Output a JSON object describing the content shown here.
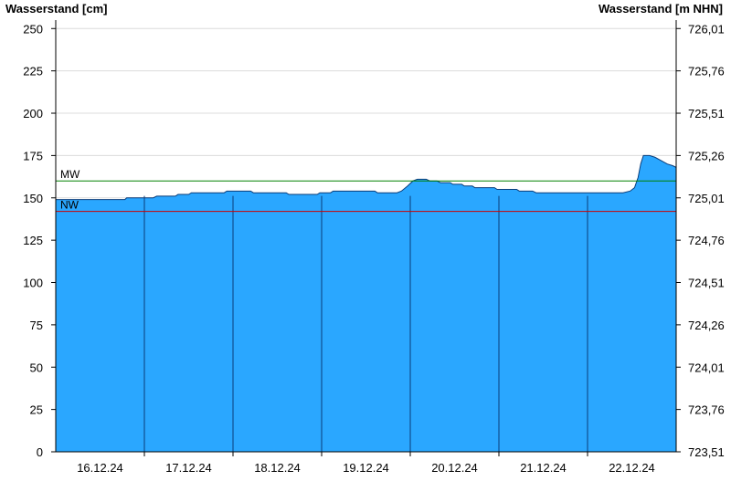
{
  "chart_data": {
    "type": "area",
    "ylabel_left": "Wasserstand [cm]",
    "ylabel_right": "Wasserstand [m NHN]",
    "ylim": [
      0,
      255
    ],
    "yticks_left": [
      "0",
      "25",
      "50",
      "75",
      "100",
      "125",
      "150",
      "175",
      "200",
      "225",
      "250"
    ],
    "yticks_left_values": [
      0,
      25,
      50,
      75,
      100,
      125,
      150,
      175,
      200,
      225,
      250
    ],
    "yticks_right": [
      "723,51",
      "723,76",
      "724,01",
      "724,26",
      "724,51",
      "724,76",
      "725,01",
      "725,26",
      "725,51",
      "725,76",
      "726,01"
    ],
    "xlim": [
      0,
      7
    ],
    "xticks": [
      "16.12.24",
      "17.12.24",
      "18.12.24",
      "19.12.24",
      "20.12.24",
      "21.12.24",
      "22.12.24"
    ],
    "xtick_positions": [
      0.5,
      1.5,
      2.5,
      3.5,
      4.5,
      5.5,
      6.5
    ],
    "day_separators": [
      1,
      2,
      3,
      4,
      5,
      6
    ],
    "reference_lines": [
      {
        "label": "MW",
        "value": 160,
        "color": "#008000"
      },
      {
        "label": "NW",
        "value": 142,
        "color": "#cc0000"
      }
    ],
    "series": [
      {
        "color": "#2aa7ff",
        "points": [
          [
            0,
            149
          ],
          [
            0.78,
            149
          ],
          [
            0.8,
            150
          ],
          [
            1.1,
            150
          ],
          [
            1.14,
            151
          ],
          [
            1.35,
            151
          ],
          [
            1.38,
            152
          ],
          [
            1.5,
            152
          ],
          [
            1.53,
            153
          ],
          [
            1.9,
            153
          ],
          [
            1.93,
            154
          ],
          [
            2.2,
            154
          ],
          [
            2.23,
            153
          ],
          [
            2.6,
            153
          ],
          [
            2.63,
            152
          ],
          [
            2.95,
            152
          ],
          [
            2.98,
            153
          ],
          [
            3.1,
            153
          ],
          [
            3.13,
            154
          ],
          [
            3.6,
            154
          ],
          [
            3.63,
            153
          ],
          [
            3.85,
            153
          ],
          [
            3.9,
            154
          ],
          [
            3.97,
            157
          ],
          [
            4.03,
            160
          ],
          [
            4.08,
            161
          ],
          [
            4.18,
            161
          ],
          [
            4.22,
            160
          ],
          [
            4.3,
            160
          ],
          [
            4.34,
            159
          ],
          [
            4.45,
            159
          ],
          [
            4.48,
            158
          ],
          [
            4.58,
            158
          ],
          [
            4.61,
            157
          ],
          [
            4.7,
            157
          ],
          [
            4.73,
            156
          ],
          [
            4.95,
            156
          ],
          [
            4.98,
            155
          ],
          [
            5.2,
            155
          ],
          [
            5.23,
            154
          ],
          [
            5.38,
            154
          ],
          [
            5.42,
            153
          ],
          [
            6.4,
            153
          ],
          [
            6.48,
            154
          ],
          [
            6.53,
            156
          ],
          [
            6.57,
            162
          ],
          [
            6.6,
            170
          ],
          [
            6.63,
            175
          ],
          [
            6.7,
            175
          ],
          [
            6.76,
            174
          ],
          [
            6.83,
            172
          ],
          [
            6.9,
            170
          ],
          [
            6.96,
            169
          ],
          [
            7.0,
            168
          ]
        ]
      }
    ]
  }
}
